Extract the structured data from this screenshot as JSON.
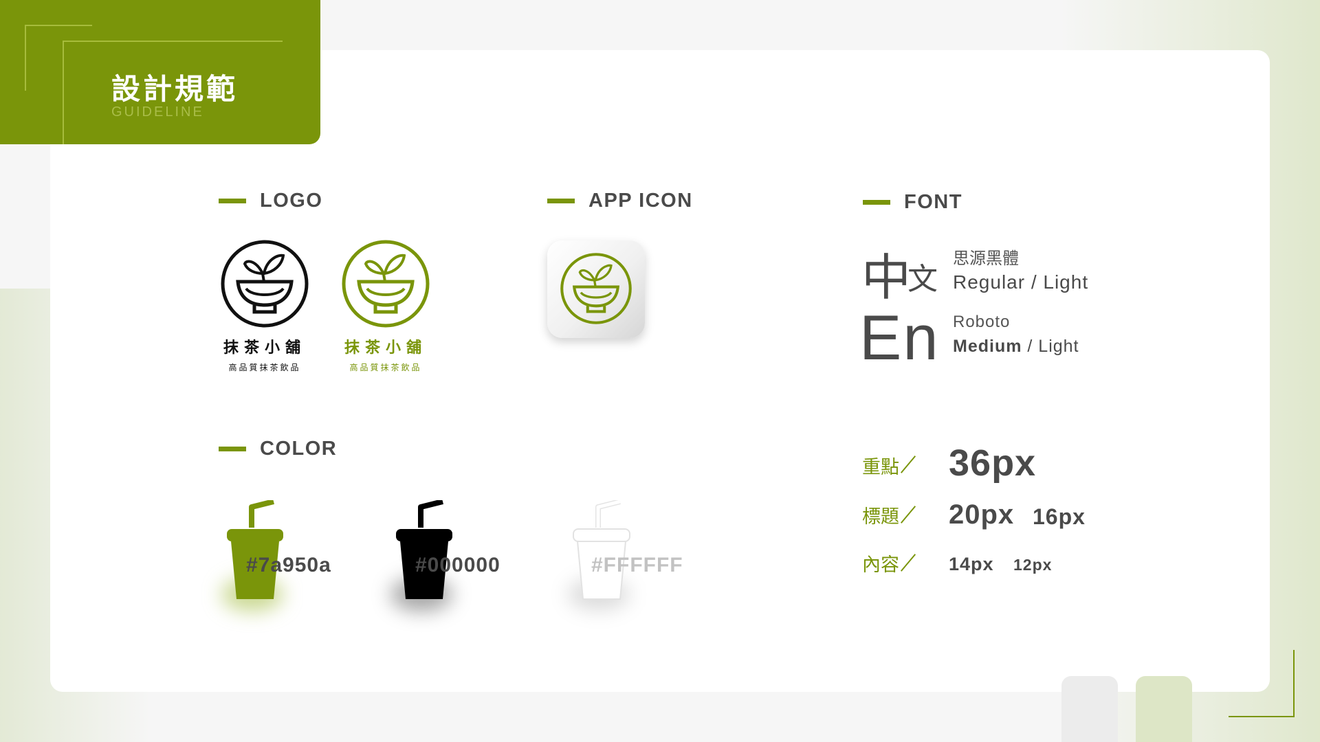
{
  "header": {
    "title_cn": "設計規範",
    "title_en": "GUIDELINE"
  },
  "sections": {
    "logo": "LOGO",
    "app_icon": "APP ICON",
    "font": "FONT",
    "color": "COLOR"
  },
  "logos": [
    {
      "name": "抹茶小舖",
      "tagline": "高品質抹茶飲品",
      "color": "#111111"
    },
    {
      "name": "抹茶小舖",
      "tagline": "高品質抹茶飲品",
      "color": "#7a950a"
    }
  ],
  "fonts": {
    "cn_big_char": "中",
    "cn_small_char": "文",
    "cn_name": "思源黑體",
    "cn_weights": "Regular / Light",
    "en_sample": "En",
    "en_name": "Roboto",
    "en_weight_bold": "Medium",
    "en_weight_rest": " / Light"
  },
  "sizes": [
    {
      "label": "重點",
      "values": [
        "36px"
      ]
    },
    {
      "label": "標題",
      "values": [
        "20px",
        "16px"
      ]
    },
    {
      "label": "內容",
      "values": [
        "14px",
        "12px"
      ]
    }
  ],
  "colors": [
    {
      "hex": "#7a950a",
      "fill": "#7a950a"
    },
    {
      "hex": "#000000",
      "fill": "#000000"
    },
    {
      "hex": "#FFFFFF",
      "fill": "#FFFFFF"
    }
  ],
  "palette": {
    "brand": "#7a950a",
    "text": "#4a4a4a",
    "background": "#f6f6f6"
  }
}
